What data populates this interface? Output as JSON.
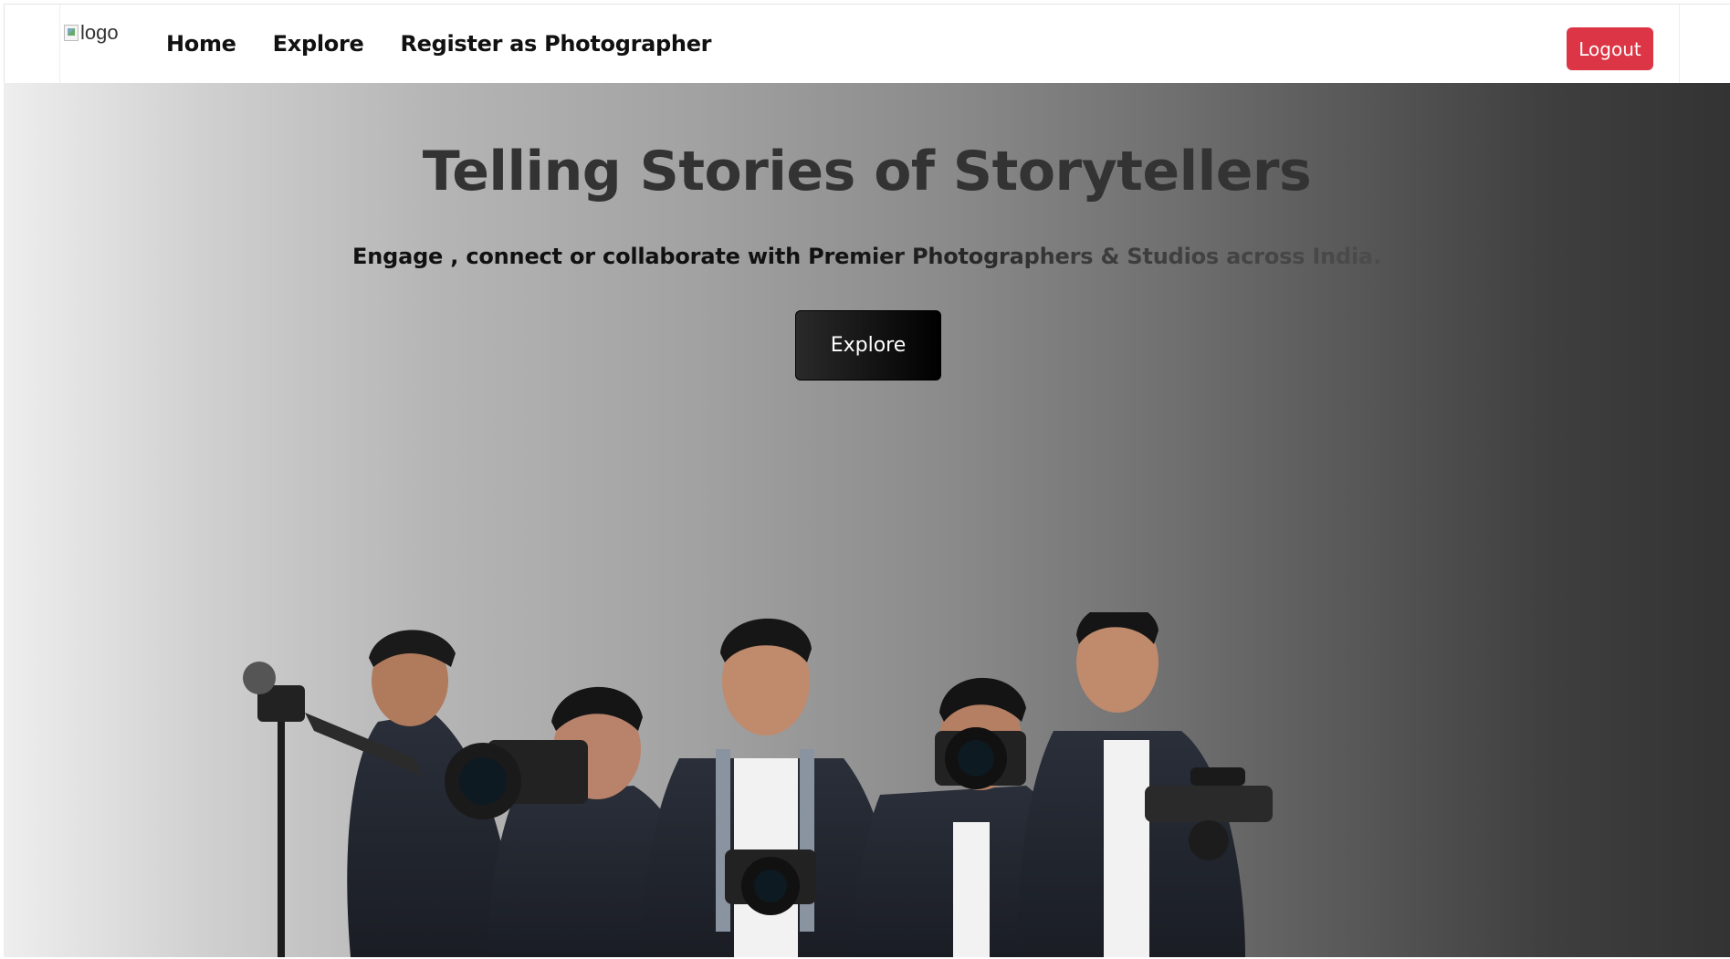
{
  "navbar": {
    "logo_alt": "logo",
    "links": [
      "Home",
      "Explore",
      "Register as Photographer"
    ],
    "logout_label": "Logout"
  },
  "hero": {
    "title": "Telling Stories of Storytellers",
    "subtitle": "Engage , connect or collaborate with Premier Photographers & Studios across India.",
    "explore_label": "Explore"
  },
  "colors": {
    "logout": "#dc3545",
    "title": "#333333",
    "button_bg": "#111111"
  }
}
